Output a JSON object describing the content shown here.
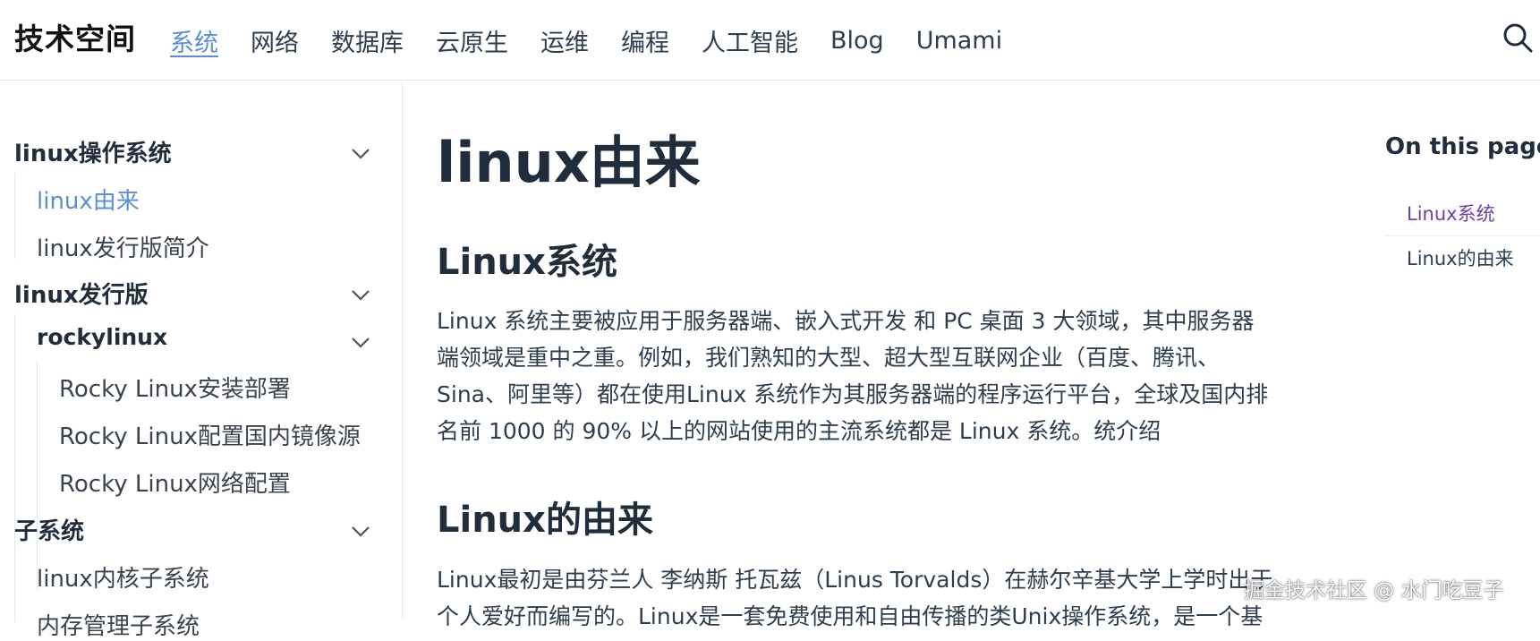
{
  "header": {
    "site_title": "技术空间",
    "nav": [
      "系统",
      "网络",
      "数据库",
      "云原生",
      "运维",
      "编程",
      "人工智能",
      "Blog",
      "Umami"
    ],
    "active_nav": "系统",
    "search_icon": "search-icon"
  },
  "sidebar": {
    "groups": [
      {
        "label": "linux操作系统",
        "items": [
          "linux由来",
          "linux发行版简介"
        ]
      },
      {
        "label": "linux发行版",
        "subgroup": {
          "label": "rockylinux",
          "items": [
            "Rocky Linux安装部署",
            "Rocky Linux配置国内镜像源",
            "Rocky Linux网络配置"
          ]
        }
      },
      {
        "label": "子系统",
        "items": [
          "linux内核子系统",
          "内存管理子系统"
        ]
      }
    ],
    "active_item": "linux由来",
    "chevron_icon": "chevron-down-icon"
  },
  "main": {
    "title": "linux由来",
    "sections": [
      {
        "heading": "Linux系统",
        "lines": [
          "Linux 系统主要被应用于服务器端、嵌入式开发 和 PC 桌面 3 大领域，其中服务器",
          "端领域是重中之重。例如，我们熟知的大型、超大型互联网企业（百度、腾讯、",
          "Sina、阿里等）都在使用Linux 系统作为其服务器端的程序运行平台，全球及国内排",
          "名前 1000 的 90% 以上的网站使用的主流系统都是 Linux 系统。统介绍"
        ]
      },
      {
        "heading": "Linux的由来",
        "lines": [
          "Linux最初是由芬兰人 李纳斯 托瓦兹（Linus Torvalds）在赫尔辛基大学上学时出于",
          "个人爱好而编写的。Linux是一套免费使用和自由传播的类Unix操作系统，是一个基"
        ]
      }
    ]
  },
  "toc": {
    "title": "On this page",
    "items": [
      "Linux系统",
      "Linux的由来"
    ],
    "active": "Linux系统"
  },
  "watermark": "掘金技术社区 @ 水门吃豆子",
  "colors": {
    "accent": "#5a8fd6",
    "toc_active": "#6b3fa0",
    "text": "#2c3e50",
    "heading": "#1f2d3d",
    "border": "#e6e8eb"
  }
}
